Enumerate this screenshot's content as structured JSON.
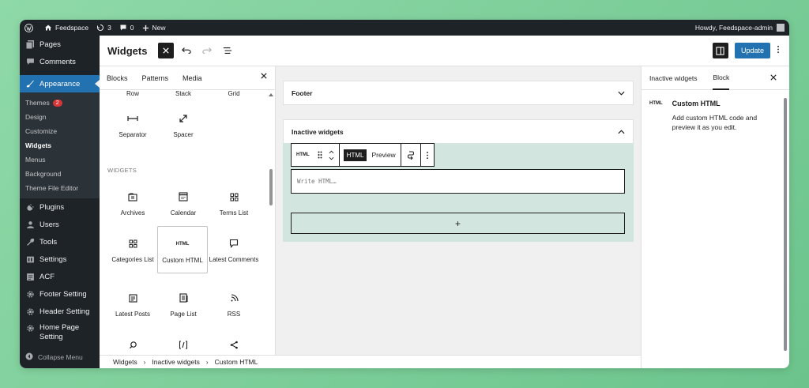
{
  "admin_bar": {
    "site_name": "Feedspace",
    "updates_count": "3",
    "comments_count": "0",
    "new_label": "New",
    "howdy": "Howdy, Feedspace-admin"
  },
  "sidebar": {
    "top_items": [
      {
        "label": "Pages",
        "icon": "pages-icon"
      },
      {
        "label": "Comments",
        "icon": "comments-icon"
      }
    ],
    "active_item": {
      "label": "Appearance",
      "icon": "brush-icon"
    },
    "submenu": [
      {
        "label": "Themes",
        "badge": "2"
      },
      {
        "label": "Design"
      },
      {
        "label": "Customize"
      },
      {
        "label": "Widgets",
        "current": true
      },
      {
        "label": "Menus"
      },
      {
        "label": "Background"
      },
      {
        "label": "Theme File Editor"
      }
    ],
    "bottom_items": [
      {
        "label": "Plugins",
        "icon": "plugin-icon"
      },
      {
        "label": "Users",
        "icon": "users-icon"
      },
      {
        "label": "Tools",
        "icon": "wrench-icon"
      },
      {
        "label": "Settings",
        "icon": "settings-icon"
      },
      {
        "label": "ACF",
        "icon": "acf-icon"
      },
      {
        "label": "Footer Setting",
        "icon": "gear-icon"
      },
      {
        "label": "Header Setting",
        "icon": "gear-icon"
      },
      {
        "label": "Home Page Setting",
        "icon": "gear-icon"
      }
    ],
    "collapse_label": "Collapse Menu"
  },
  "header": {
    "title": "Widgets",
    "update_label": "Update"
  },
  "inserter": {
    "tabs": [
      "Blocks",
      "Patterns",
      "Media"
    ],
    "partial_row": [
      "Row",
      "Stack",
      "Grid"
    ],
    "design_blocks": [
      {
        "label": "Separator",
        "icon": "separator-icon"
      },
      {
        "label": "Spacer",
        "icon": "spacer-icon"
      }
    ],
    "section_label": "WIDGETS",
    "widget_blocks": [
      {
        "label": "Archives",
        "icon": "archives-icon"
      },
      {
        "label": "Calendar",
        "icon": "calendar-icon"
      },
      {
        "label": "Terms List",
        "icon": "terms-list-icon"
      },
      {
        "label": "Categories List",
        "icon": "categories-icon"
      },
      {
        "label": "Custom HTML",
        "icon": "html-icon"
      },
      {
        "label": "Latest Comments",
        "icon": "comment-icon"
      },
      {
        "label": "Latest Posts",
        "icon": "latest-posts-icon"
      },
      {
        "label": "Page List",
        "icon": "page-list-icon"
      },
      {
        "label": "RSS",
        "icon": "rss-icon"
      }
    ],
    "html_icon_text": "HTML"
  },
  "canvas": {
    "footer_label": "Footer",
    "inactive_label": "Inactive widgets",
    "toolbar": {
      "html_tag": "HTML",
      "html_mode": "HTML",
      "preview_label": "Preview"
    },
    "code_placeholder": "Write HTML…",
    "add_label": "+"
  },
  "settings": {
    "tabs": [
      "Inactive widgets",
      "Block"
    ],
    "block_icon_text": "HTML",
    "block_title": "Custom HTML",
    "block_desc": "Add custom HTML code and preview it as you edit."
  },
  "breadcrumb": [
    "Widgets",
    "Inactive widgets",
    "Custom HTML"
  ]
}
